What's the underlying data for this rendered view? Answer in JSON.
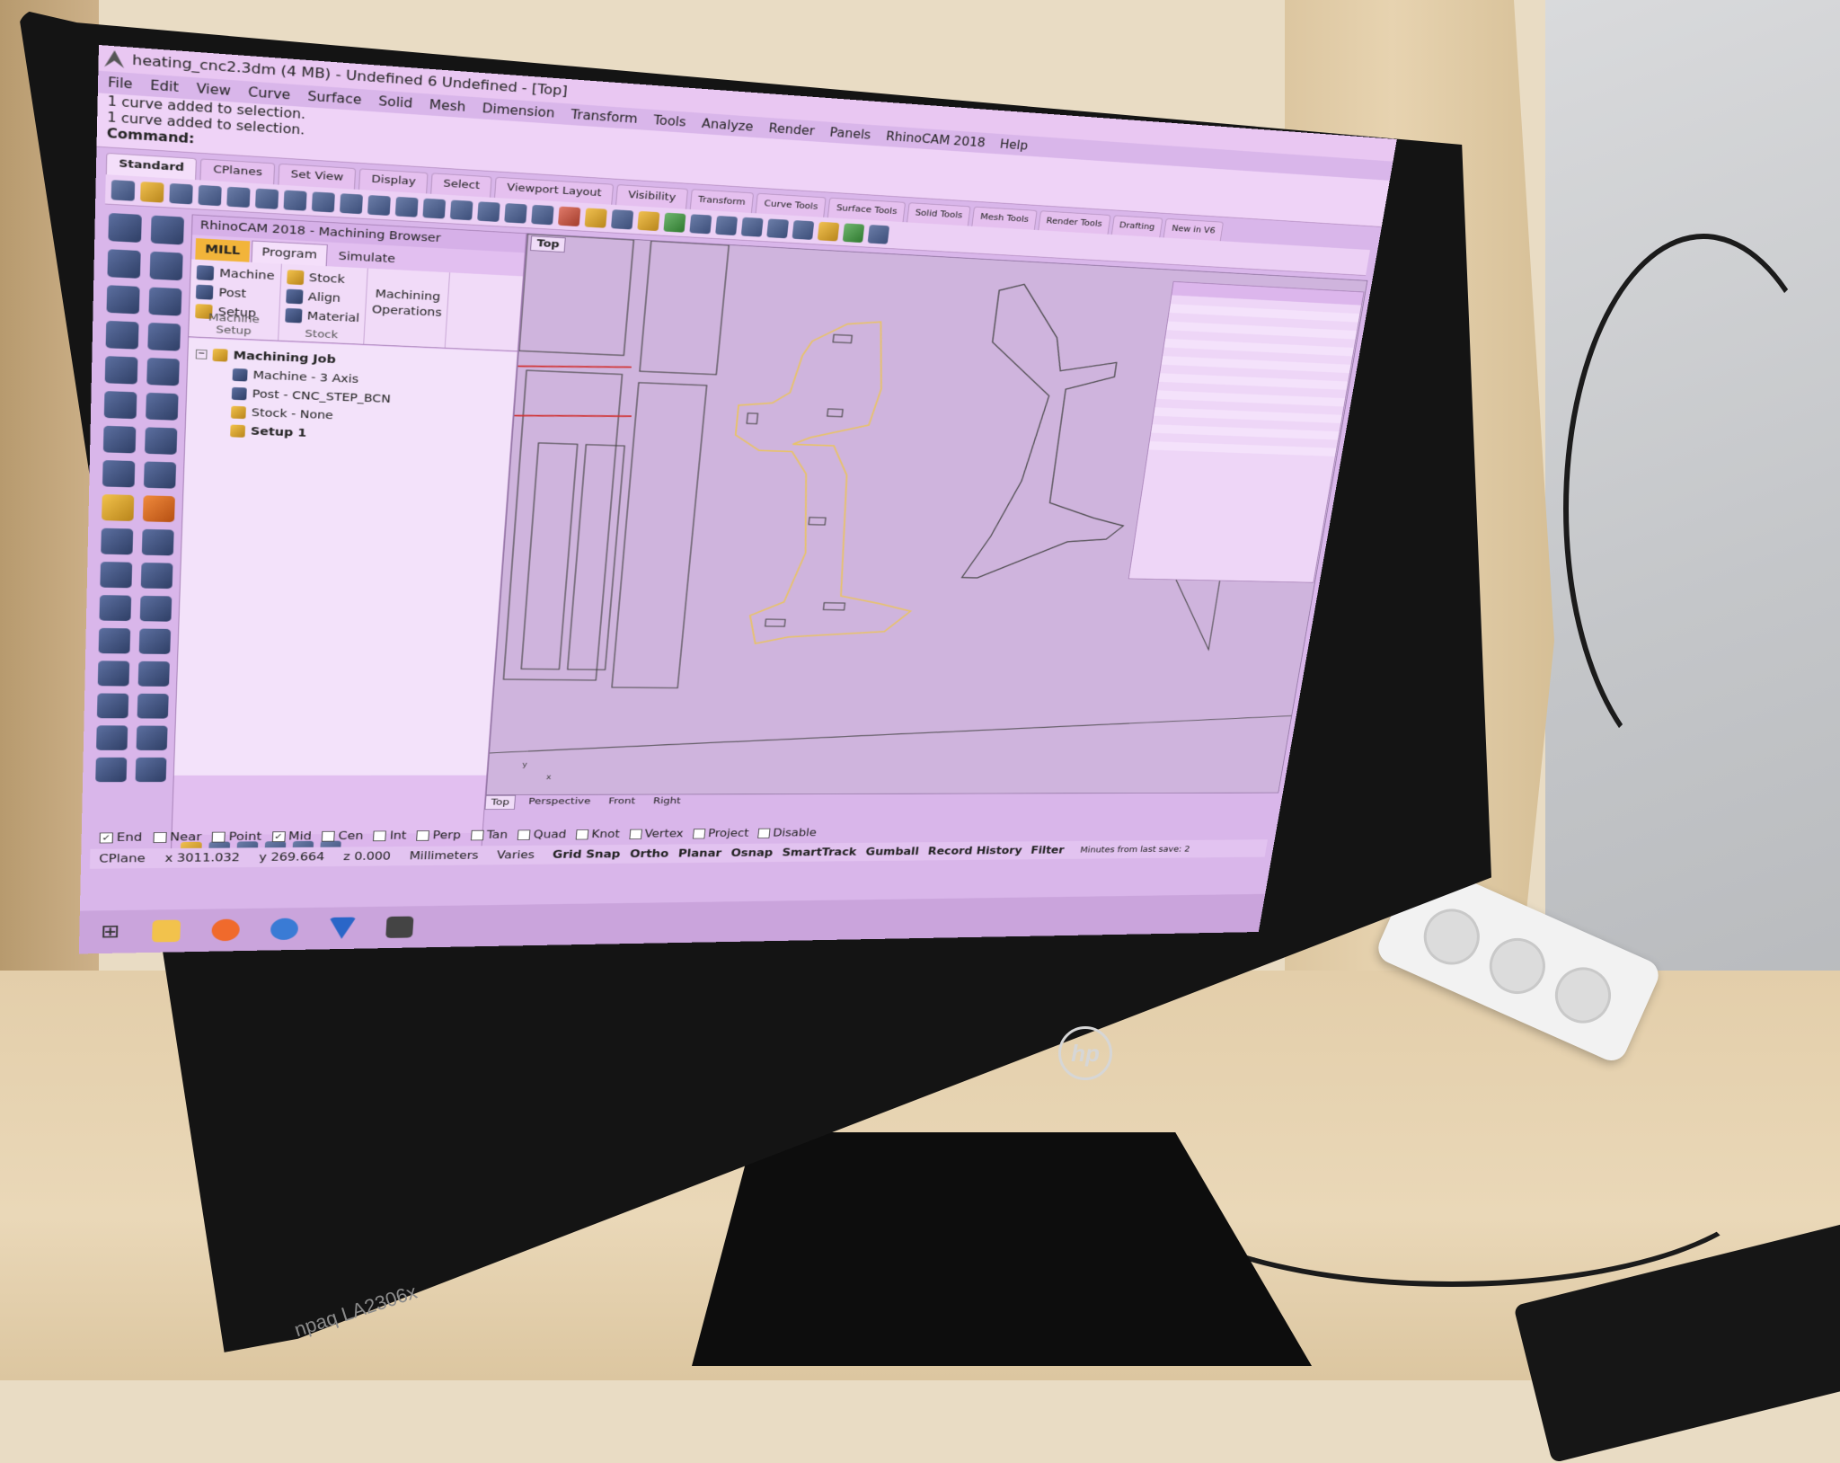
{
  "window": {
    "title": "heating_cnc2.3dm (4 MB) - Undefined 6 Undefined - [Top]"
  },
  "menu": [
    "File",
    "Edit",
    "View",
    "Curve",
    "Surface",
    "Solid",
    "Mesh",
    "Dimension",
    "Transform",
    "Tools",
    "Analyze",
    "Render",
    "Panels",
    "RhinoCAM 2018",
    "Help"
  ],
  "command_history": [
    "1 curve added to selection.",
    "1 curve added to selection."
  ],
  "command_prompt": "Command:",
  "toolbar_tabs": [
    "Standard",
    "CPlanes",
    "Set View",
    "Display",
    "Select",
    "Viewport Layout",
    "Visibility",
    "Transform",
    "Curve Tools",
    "Surface Tools",
    "Solid Tools",
    "Mesh Tools",
    "Render Tools",
    "Drafting",
    "New in V6"
  ],
  "browser": {
    "title": "RhinoCAM 2018 - Machining Browser",
    "tabs": [
      "MILL",
      "Program",
      "Simulate"
    ],
    "ribbon": {
      "machine_setup": {
        "items": [
          "Machine",
          "Post",
          "Setup"
        ],
        "label": "Machine Setup"
      },
      "stock": {
        "items": [
          "Stock",
          "Align",
          "Material"
        ],
        "label": "Stock"
      },
      "ops": {
        "items": [
          "Machining",
          "Operations"
        ]
      }
    },
    "tree": {
      "root": "Machining Job",
      "children": [
        "Machine - 3 Axis",
        "Post - CNC_STEP_BCN",
        "Stock - None",
        "Setup 1"
      ]
    }
  },
  "viewport": {
    "name": "Top",
    "tabs": [
      "Top",
      "Perspective",
      "Front",
      "Right"
    ]
  },
  "osnaps": [
    {
      "label": "End",
      "checked": true
    },
    {
      "label": "Near",
      "checked": false
    },
    {
      "label": "Point",
      "checked": false
    },
    {
      "label": "Mid",
      "checked": true
    },
    {
      "label": "Cen",
      "checked": false
    },
    {
      "label": "Int",
      "checked": false
    },
    {
      "label": "Perp",
      "checked": false
    },
    {
      "label": "Tan",
      "checked": false
    },
    {
      "label": "Quad",
      "checked": false
    },
    {
      "label": "Knot",
      "checked": false
    },
    {
      "label": "Vertex",
      "checked": false
    },
    {
      "label": "Project",
      "checked": false
    },
    {
      "label": "Disable",
      "checked": false
    }
  ],
  "status": {
    "cplane": "CPlane",
    "x": "x 3011.032",
    "y": "y 269.664",
    "z": "z 0.000",
    "units": "Millimeters",
    "layer": "Varies",
    "toggles": [
      "Grid Snap",
      "Ortho",
      "Planar",
      "Osnap",
      "SmartTrack",
      "Gumball",
      "Record History",
      "Filter"
    ],
    "message": "Minutes from last save: 2"
  },
  "monitor": {
    "brand": "hp",
    "model": "npaq LA2306x"
  },
  "colors": {
    "screen_tint": "#d9b6ea",
    "selection": "#e8c26a",
    "accent_mill": "#f2b43a"
  }
}
